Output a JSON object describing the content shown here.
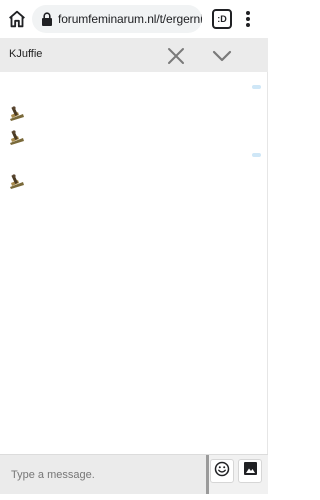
{
  "browser": {
    "url": "forumfeminarum.nl/t/ergerni",
    "tab_count": ":D",
    "icons": {
      "home": "home-icon",
      "lock": "lock-icon",
      "menu": "more-vert-icon"
    }
  },
  "chat": {
    "contact_name": "KJuffie",
    "header_bg": "#ebebeb"
  },
  "messages": [
    {
      "type": "read-indicator"
    },
    {
      "type": "emoji",
      "icon": "woodworking-plane-emoji"
    },
    {
      "type": "emoji",
      "icon": "woodworking-plane-emoji"
    },
    {
      "type": "read-indicator"
    },
    {
      "type": "emoji",
      "icon": "woodworking-plane-emoji"
    }
  ],
  "composer": {
    "placeholder": "Type a message.",
    "value": "",
    "buttons": {
      "emoji": "smiley-icon",
      "image": "image-icon"
    }
  }
}
